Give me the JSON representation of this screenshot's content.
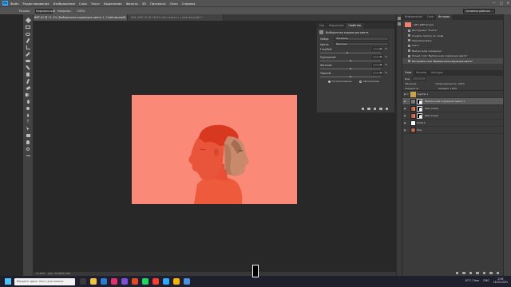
{
  "menu": {
    "logo": "Ps",
    "items": [
      "Файл",
      "Редактирование",
      "Изображение",
      "Слои",
      "Текст",
      "Выделение",
      "Фильтр",
      "3D",
      "Просмотр",
      "Окно",
      "Справка"
    ]
  },
  "options": {
    "mode_label": "Режим:",
    "mode_value": "Нормальный",
    "opacity_label": "Непрозр.:",
    "opacity_value": "100%",
    "workspace": "Основная рабочая среда"
  },
  "tabs": [
    "ANT_WEF-ID @ 11,1% (Выборочная коррекция цвета 1, Слой-маска/8) *",
    "ANT_WEF-ID @ 16,6% (Без маски 1 слой-маска/8) *"
  ],
  "canvas": {
    "background": "#fb8977",
    "zoom": "11,06%",
    "doc_info": "Док: 25,9M/57,6M"
  },
  "properties": {
    "tabs": [
      "Сво",
      "Коррекция",
      "Свойства"
    ],
    "active_tab": "Свойства",
    "header": "Выборочная коррекция цвета",
    "preset_label": "Набор:",
    "preset_value": "Заказная",
    "colors_label": "Цвета:",
    "colors_value": "Красные",
    "sliders": [
      {
        "label": "Голубой:",
        "value": "-9",
        "pos": 0.45
      },
      {
        "label": "Пурпурный:",
        "value": "0",
        "pos": 0.5
      },
      {
        "label": "Желтый:",
        "value": "0",
        "pos": 0.5
      },
      {
        "label": "Черный:",
        "value": "0",
        "pos": 0.5
      }
    ],
    "radio_relative": "Относительные",
    "radio_absolute": "Абсолютные"
  },
  "history": {
    "tabs": [
      "Информация",
      "Слои",
      "История"
    ],
    "active_tab": "История",
    "snapshot": "ANT_WEF-ID.psd",
    "items": [
      "Инструмент \"Кисть\"",
      "Создать группу из слоёв",
      "Переименовать",
      "Текст",
      "Выборочная коррекция",
      "Новый слой \"Выборочная коррекция цвета\"",
      "Настройка слоя \"Выборочная коррекция цвета\""
    ],
    "selected_index": 6
  },
  "layers": {
    "tabs": [
      "Слои",
      "Каналы",
      "Контуры"
    ],
    "active_tab": "Слои",
    "kind_label": "Вид",
    "blend_value": "Обычные",
    "opacity_label": "Непрозрачность:",
    "opacity_value": "100%",
    "lock_label": "Закрепить:",
    "fill_label": "Заливка:",
    "fill_value": "100%",
    "list": [
      {
        "name": "Группа 1",
        "type": "group"
      },
      {
        "name": "Выборочная коррекция цвета 1",
        "type": "adjust",
        "selected": true
      },
      {
        "name": "Фон копия",
        "type": "photo-mask"
      },
      {
        "name": "Фон копия",
        "type": "photo-mask"
      },
      {
        "name": "Слой 1",
        "type": "white"
      },
      {
        "name": "Фон",
        "type": "photo"
      }
    ]
  },
  "taskbar": {
    "search_placeholder": "Введите здесь текст для поиска",
    "weather": "10°C Clear",
    "lang": "ENG",
    "time": "2:08",
    "date": "18.05.2021"
  },
  "colors": {
    "canvas_bg": "#fb8977",
    "accent": "#31a8ff",
    "panel": "#3b3b3b"
  }
}
